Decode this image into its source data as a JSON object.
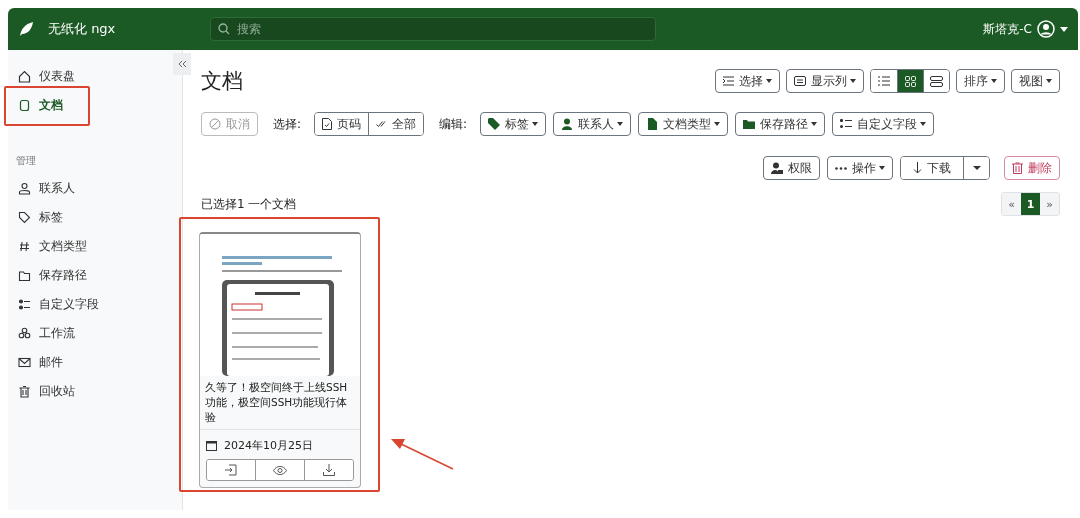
{
  "app": {
    "name": "无纸化 ngx"
  },
  "search": {
    "placeholder": "搜索"
  },
  "user": {
    "name": "斯塔克-C"
  },
  "sidebar": {
    "items": [
      {
        "label": "仪表盘",
        "selected": false
      },
      {
        "label": "文档",
        "selected": true
      }
    ],
    "section_title": "管理",
    "manage_items": [
      {
        "label": "联系人"
      },
      {
        "label": "标签"
      },
      {
        "label": "文档类型"
      },
      {
        "label": "保存路径"
      },
      {
        "label": "自定义字段"
      },
      {
        "label": "工作流"
      },
      {
        "label": "邮件"
      },
      {
        "label": "回收站"
      }
    ]
  },
  "page": {
    "title": "文档"
  },
  "toolbar": {
    "select_button": "选择",
    "columns_button": "显示列",
    "view_modes": [
      {
        "selected": false
      },
      {
        "selected": true
      },
      {
        "selected": false
      }
    ],
    "sort_button": "排序",
    "views_button": "视图"
  },
  "bulk_bar": {
    "cancel": {
      "label": "取消",
      "disabled": true
    },
    "select_label": "选择:",
    "select_buttons": [
      "页码",
      "全部"
    ],
    "edit_label": "编辑:",
    "edit_buttons": [
      "标签",
      "联系人",
      "文档类型",
      "保存路径",
      "自定义字段"
    ]
  },
  "actions": [
    {
      "label": "权限",
      "kind": "plain"
    },
    {
      "label": "操作",
      "kind": "dropdown"
    },
    {
      "label": "下载",
      "kind": "split"
    },
    {
      "label": "删除",
      "kind": "danger"
    }
  ],
  "selection_text": "已选择1 一个文档",
  "pagination": [
    {
      "label": "«",
      "selected": false
    },
    {
      "label": "1",
      "selected": true
    },
    {
      "label": "»",
      "selected": false
    }
  ],
  "documents": [
    {
      "kind": "picture",
      "title": "久等了！极空间终于上线SSH功能，极空间SSH功能现行体验",
      "date": "2024年10月25日"
    }
  ]
}
